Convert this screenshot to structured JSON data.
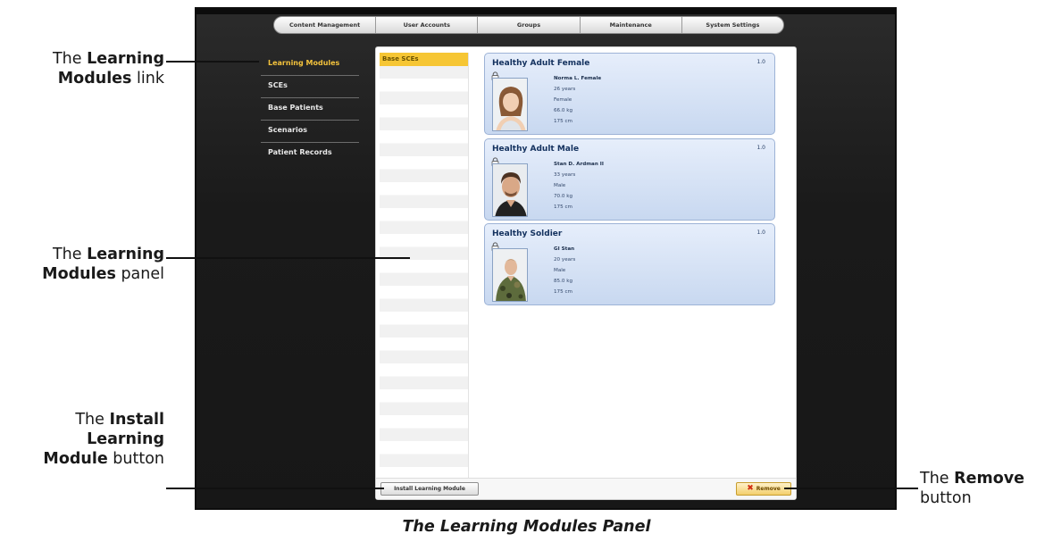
{
  "top_nav": {
    "tabs": [
      "Content Management",
      "User Accounts",
      "Groups",
      "Maintenance",
      "System Settings"
    ]
  },
  "sidebar": {
    "items": [
      {
        "label": "Learning Modules",
        "active": true
      },
      {
        "label": "SCEs",
        "active": false
      },
      {
        "label": "Base Patients",
        "active": false
      },
      {
        "label": "Scenarios",
        "active": false
      },
      {
        "label": "Patient Records",
        "active": false
      }
    ]
  },
  "learning_modules_list": {
    "items": [
      "Base SCEs"
    ]
  },
  "patients": [
    {
      "title": "Healthy Adult Female",
      "version": "1.0",
      "name": "Norma L. Female",
      "age": "26 years",
      "sex": "Female",
      "weight": "66.0 kg",
      "height": "175 cm",
      "portrait": "female-portrait"
    },
    {
      "title": "Healthy Adult Male",
      "version": "1.0",
      "name": "Stan D. Ardman II",
      "age": "33 years",
      "sex": "Male",
      "weight": "70.0 kg",
      "height": "175 cm",
      "portrait": "male-portrait"
    },
    {
      "title": "Healthy Soldier",
      "version": "1.0",
      "name": "GI Stan",
      "age": "20 years",
      "sex": "Male",
      "weight": "85.0 kg",
      "height": "175 cm",
      "portrait": "soldier-portrait"
    }
  ],
  "footer": {
    "install_label": "Install Learning Module",
    "remove_label": "Remove"
  },
  "callouts": {
    "link": {
      "pre": "The ",
      "bold": "Learning",
      "bold2": "Modules",
      "post": " link"
    },
    "panel": {
      "pre": "The ",
      "bold": "Learning",
      "bold2": "Modules",
      "post": " panel"
    },
    "install": {
      "pre": "The ",
      "bold": "Install",
      "bold2": "Learning",
      "bold3": "Module",
      "post": " button"
    },
    "remove": {
      "pre": "The ",
      "bold": "Remove",
      "post": "button"
    }
  },
  "caption": "The Learning Modules Panel",
  "colors": {
    "active_nav": "#f3c23c",
    "card_bg": "#dbe6f7",
    "card_title": "#13315e",
    "selected_module": "#f6c634"
  }
}
